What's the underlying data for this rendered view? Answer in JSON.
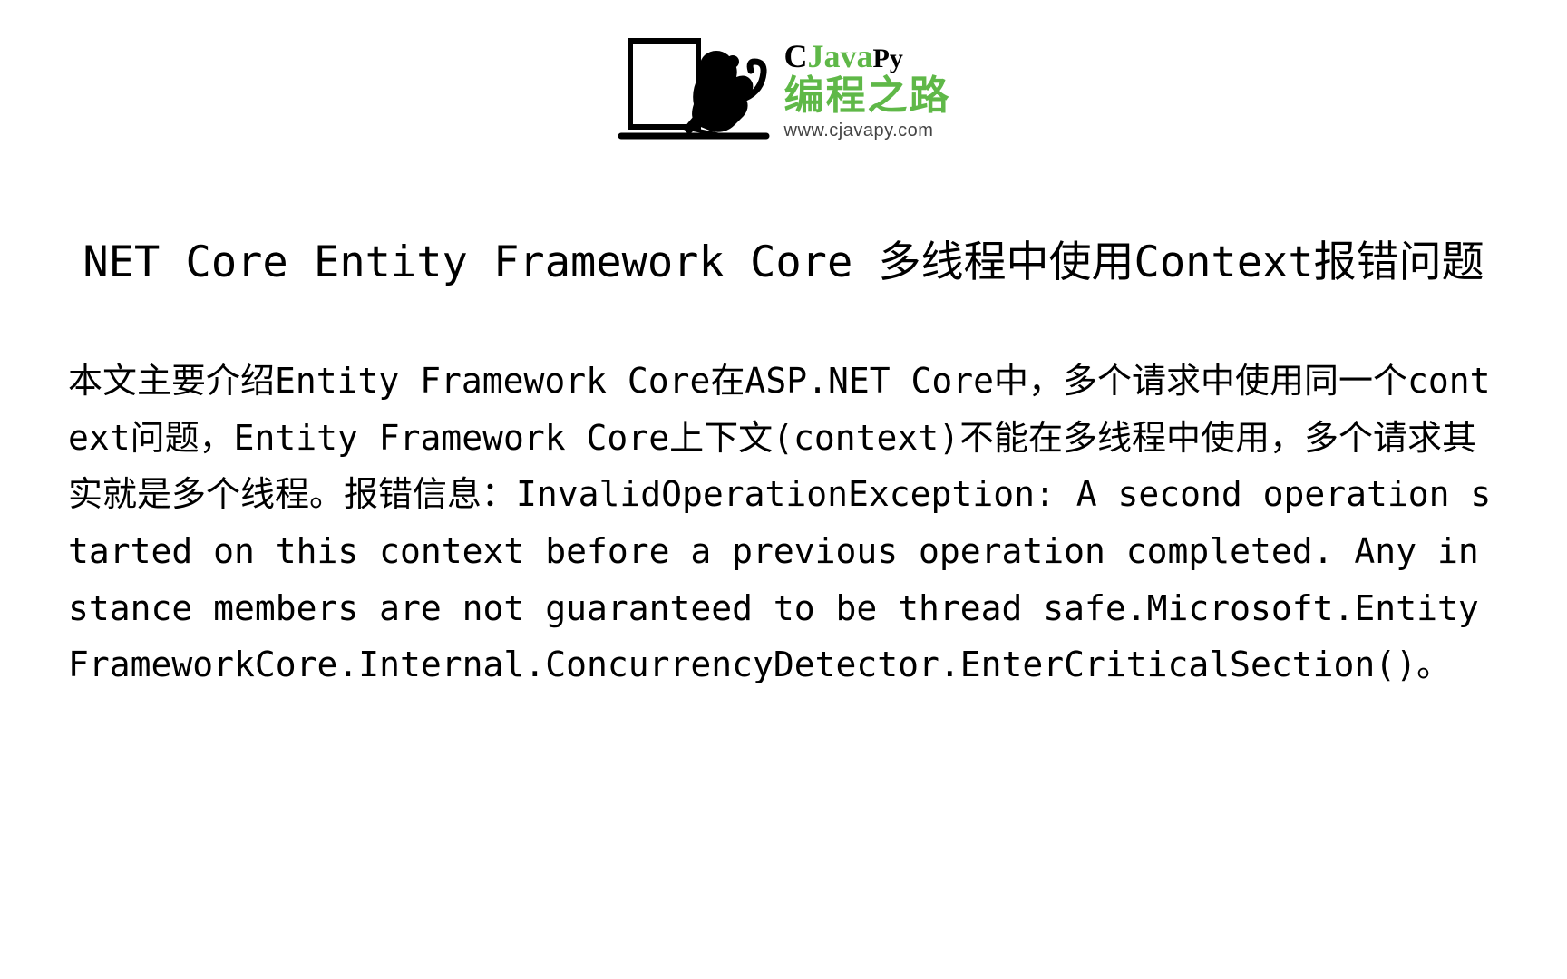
{
  "logo": {
    "line1_c": "C",
    "line1_java": "Java",
    "line1_py": "Py",
    "line2": "编程之路",
    "line3": "www.cjavapy.com"
  },
  "article": {
    "title": "NET Core Entity Framework Core 多线程中使用Context报错问题",
    "body": "本文主要介绍Entity Framework Core在ASP.NET Core中，多个请求中使用同一个context问题，Entity Framework Core上下文(context)不能在多线程中使用，多个请求其实就是多个线程。报错信息：InvalidOperationException: A second operation started on this context before a previous operation completed. Any instance members are not guaranteed to be thread safe.Microsoft.EntityFrameworkCore.Internal.ConcurrencyDetector.EnterCriticalSection()。"
  }
}
